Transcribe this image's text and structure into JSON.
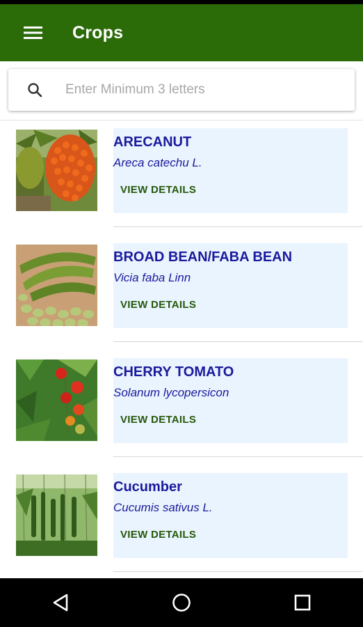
{
  "app_bar": {
    "title": "Crops",
    "menu_icon": "hamburger-menu-icon",
    "background": "#2b6b08"
  },
  "search": {
    "placeholder": "Enter Minimum 3 letters",
    "value": "",
    "icon": "search-icon"
  },
  "crops": [
    {
      "name": "ARECANUT",
      "scientific_name": "Areca catechu L.",
      "action": "VIEW DETAILS",
      "image": "arecanut-photo"
    },
    {
      "name": "BROAD BEAN/FABA BEAN",
      "scientific_name": "Vicia faba Linn",
      "action": "VIEW DETAILS",
      "image": "broad-bean-photo"
    },
    {
      "name": "CHERRY TOMATO",
      "scientific_name": "Solanum lycopersicon",
      "action": "VIEW DETAILS",
      "image": "cherry-tomato-photo"
    },
    {
      "name": "Cucumber",
      "scientific_name": "Cucumis sativus L.",
      "action": "VIEW DETAILS",
      "image": "cucumber-photo"
    }
  ],
  "colors": {
    "accent": "#2b6b08",
    "crop_name": "#1a1a9c",
    "card_background": "#eaf4fe",
    "action_text": "#25580b"
  },
  "nav": {
    "back_icon": "back-triangle-icon",
    "home_icon": "home-circle-icon",
    "recents_icon": "recents-square-icon"
  }
}
